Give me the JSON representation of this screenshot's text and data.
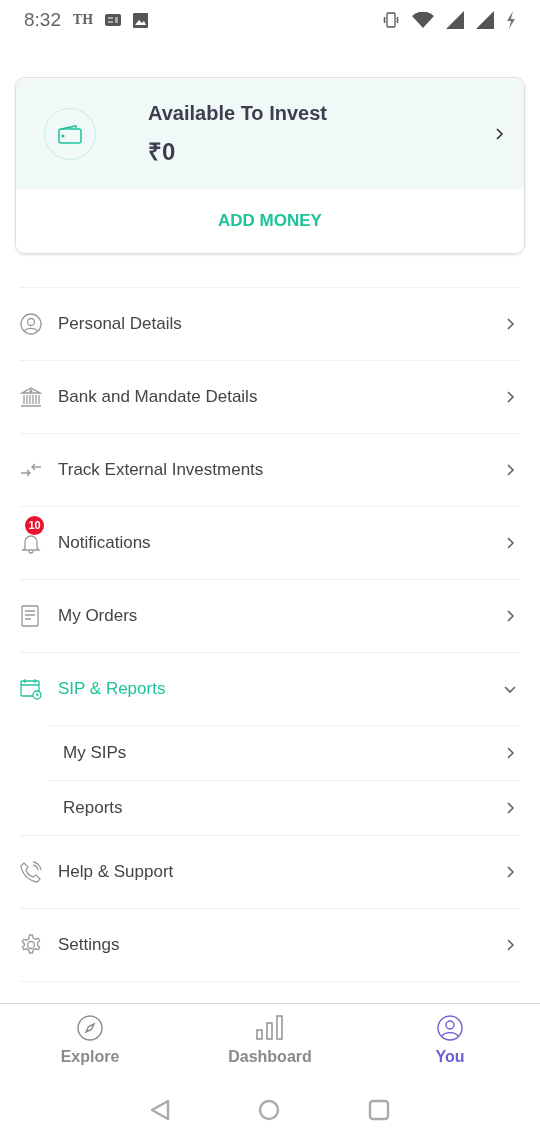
{
  "status_bar": {
    "time": "8:32",
    "carrier": "TH"
  },
  "balance_card": {
    "title": "Available To Invest",
    "amount": "₹0",
    "action": "ADD MONEY"
  },
  "menu": [
    {
      "label": "Personal Details"
    },
    {
      "label": "Bank and Mandate Details"
    },
    {
      "label": "Track External Investments"
    },
    {
      "label": "Notifications",
      "badge": "10"
    },
    {
      "label": "My Orders"
    },
    {
      "label": "SIP & Reports",
      "expanded": true,
      "children": [
        {
          "label": "My SIPs"
        },
        {
          "label": "Reports"
        }
      ]
    },
    {
      "label": "Help & Support"
    },
    {
      "label": "Settings"
    }
  ],
  "tabs": [
    {
      "label": "Explore",
      "selected": false
    },
    {
      "label": "Dashboard",
      "selected": false
    },
    {
      "label": "You",
      "selected": true
    }
  ]
}
